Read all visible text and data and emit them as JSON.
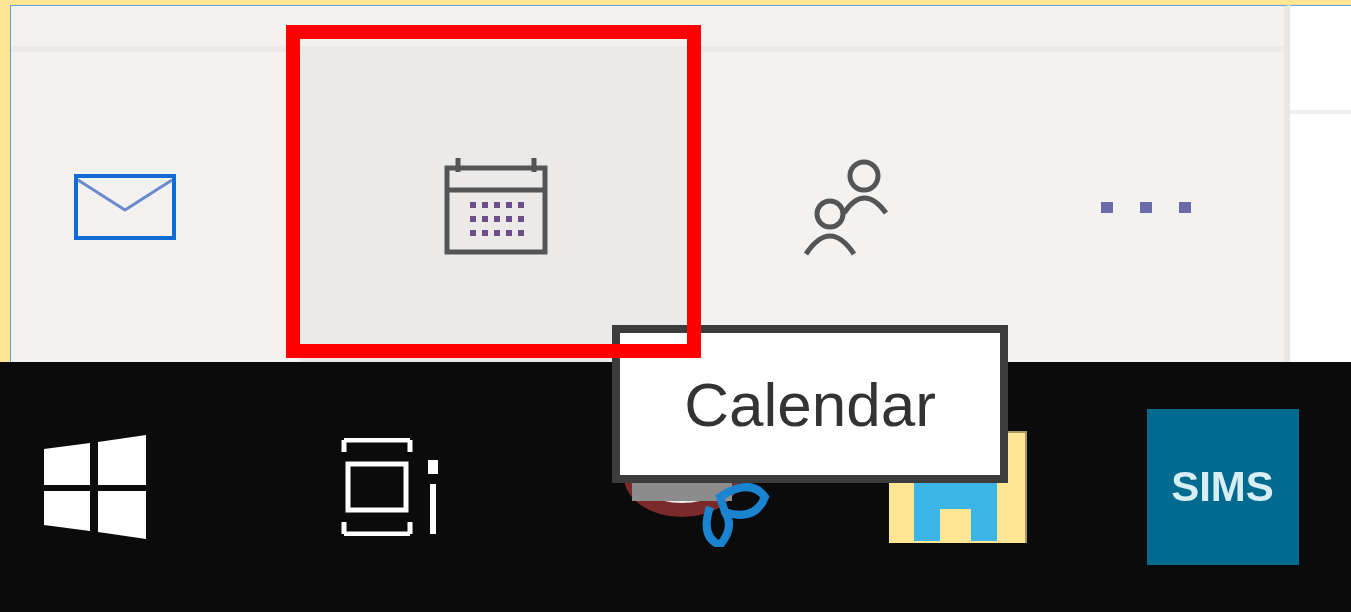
{
  "nav_items": [
    {
      "kind": "mail",
      "selected": false
    },
    {
      "kind": "calendar",
      "selected": true
    },
    {
      "kind": "people",
      "selected": false
    },
    {
      "kind": "more",
      "selected": false
    }
  ],
  "tooltip": {
    "text": "Calendar"
  },
  "taskbar": [
    {
      "kind": "start"
    },
    {
      "kind": "task-view"
    },
    {
      "kind": "snipping"
    },
    {
      "kind": "explorer"
    },
    {
      "kind": "app",
      "label": "SIMS"
    }
  ]
}
